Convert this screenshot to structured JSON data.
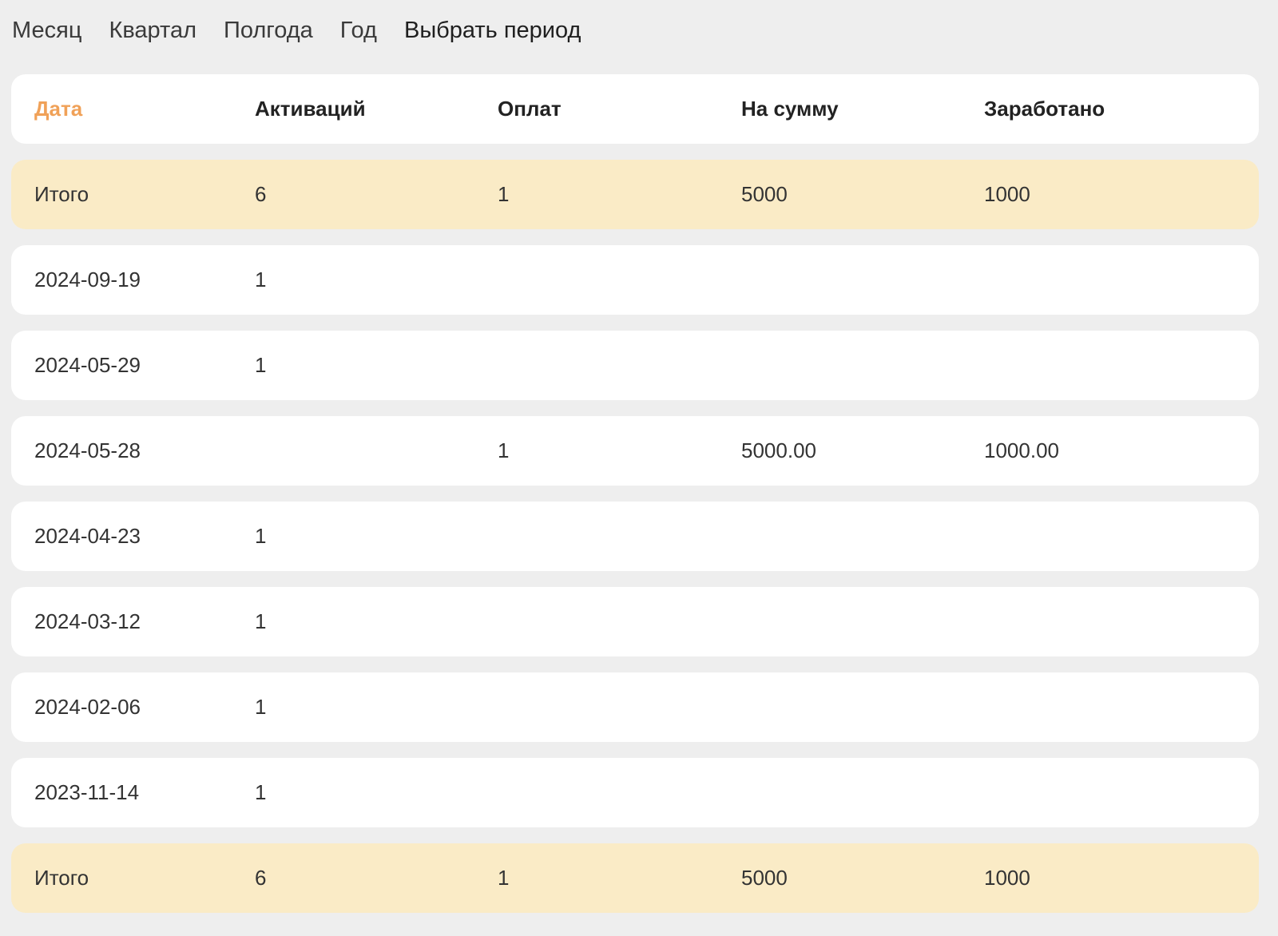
{
  "period_tabs": [
    "Месяц",
    "Квартал",
    "Полгода",
    "Год",
    "Выбрать период"
  ],
  "columns": [
    "Дата",
    "Активаций",
    "Оплат",
    "На сумму",
    "Заработано"
  ],
  "colors": {
    "sorted_header": "#f0a158",
    "total_row_bg": "#faebc6",
    "page_bg": "#eeeeee",
    "row_bg": "#ffffff"
  },
  "top_total": [
    "Итого",
    "6",
    "1",
    "5000",
    "1000"
  ],
  "rows": [
    [
      "2024-09-19",
      "1",
      "",
      "",
      ""
    ],
    [
      "2024-05-29",
      "1",
      "",
      "",
      ""
    ],
    [
      "2024-05-28",
      "",
      "1",
      "5000.00",
      "1000.00"
    ],
    [
      "2024-04-23",
      "1",
      "",
      "",
      ""
    ],
    [
      "2024-03-12",
      "1",
      "",
      "",
      ""
    ],
    [
      "2024-02-06",
      "1",
      "",
      "",
      ""
    ],
    [
      "2023-11-14",
      "1",
      "",
      "",
      ""
    ]
  ],
  "bottom_total": [
    "Итого",
    "6",
    "1",
    "5000",
    "1000"
  ]
}
